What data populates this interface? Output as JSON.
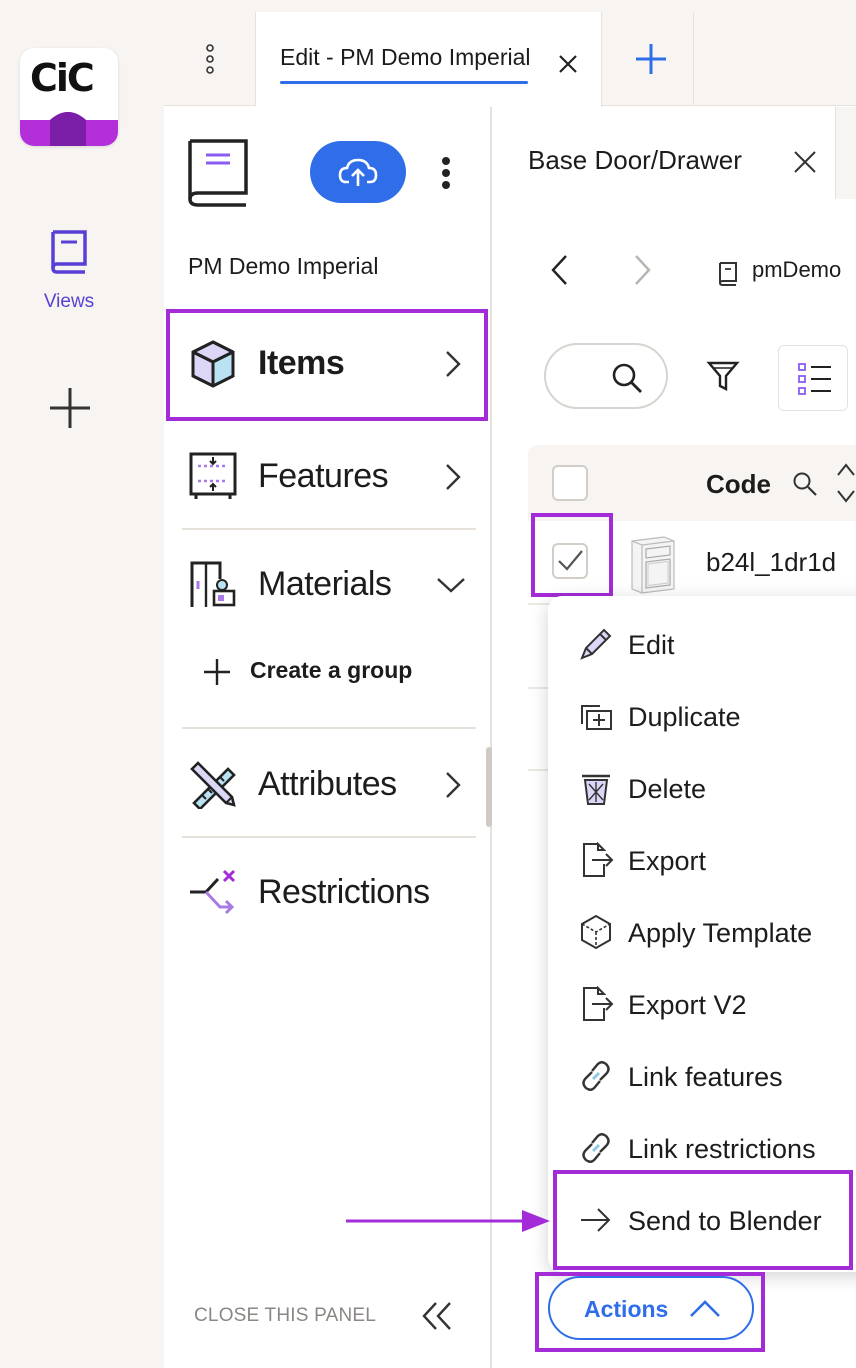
{
  "app": {
    "logo_text": "CiC"
  },
  "rail": {
    "views_label": "Views"
  },
  "tabs": {
    "active_label": "Edit - PM Demo Imperial"
  },
  "nav": {
    "project_name": "PM Demo Imperial",
    "items": [
      {
        "label": "Items",
        "icon": "cube-icon"
      },
      {
        "label": "Features",
        "icon": "cabinet-features-icon"
      },
      {
        "label": "Materials",
        "icon": "materials-icon"
      },
      {
        "label": "Attributes",
        "icon": "pencil-ruler-icon"
      },
      {
        "label": "Restrictions",
        "icon": "restrictions-icon"
      }
    ],
    "create_group_label": "Create a group",
    "close_panel_label": "CLOSE THIS PANEL"
  },
  "content": {
    "tab_label": "Base Door/Drawer",
    "breadcrumb": "pmDemo",
    "table": {
      "column_code": "Code",
      "rows": [
        {
          "code": "b24l_1dr1d",
          "checked": true
        }
      ]
    }
  },
  "menu": {
    "items": [
      {
        "label": "Edit",
        "icon": "pencil-icon"
      },
      {
        "label": "Duplicate",
        "icon": "duplicate-icon"
      },
      {
        "label": "Delete",
        "icon": "trash-icon"
      },
      {
        "label": "Export",
        "icon": "export-icon"
      },
      {
        "label": "Apply Template",
        "icon": "template-icon"
      },
      {
        "label": "Export V2",
        "icon": "export-icon"
      },
      {
        "label": "Link features",
        "icon": "link-icon"
      },
      {
        "label": "Link restrictions",
        "icon": "link-icon"
      },
      {
        "label": "Send to Blender",
        "icon": "arrow-right-icon"
      }
    ]
  },
  "actions_label": "Actions",
  "colors": {
    "accent_blue": "#2f6ee8",
    "highlight_purple": "#a42bd8",
    "nav_purple": "#5a3fd6"
  }
}
